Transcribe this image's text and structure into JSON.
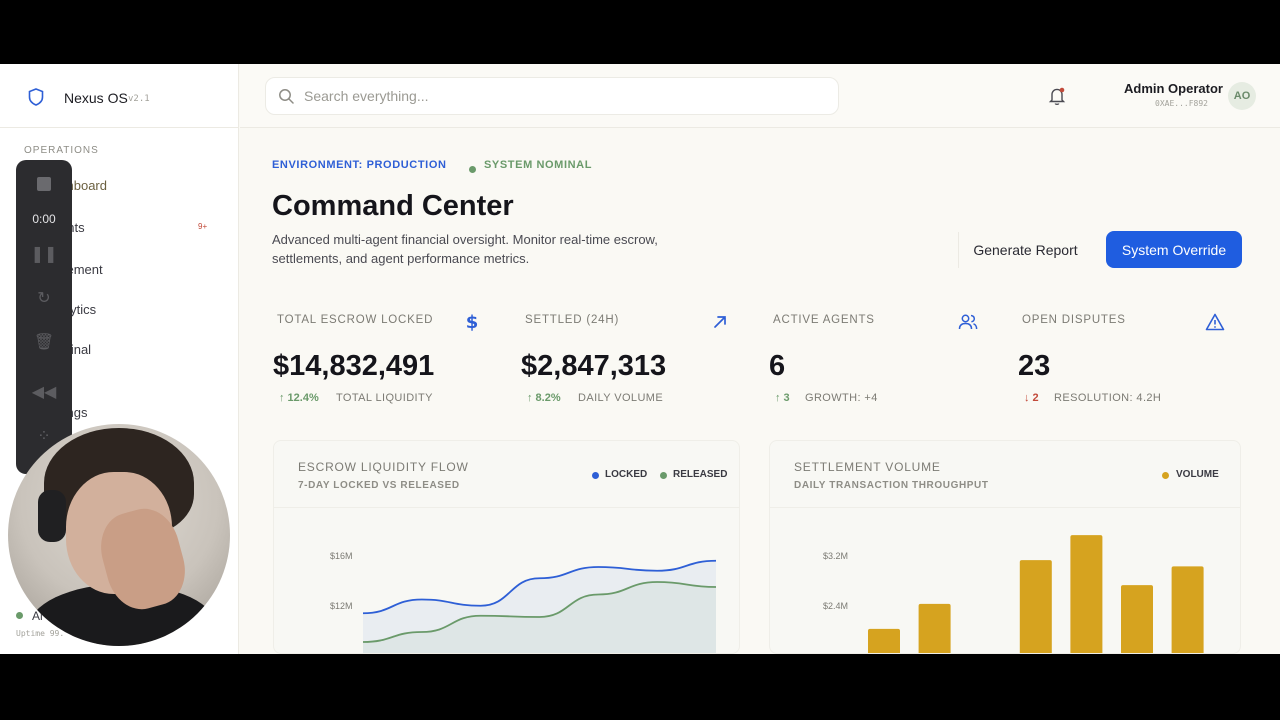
{
  "app": {
    "name": "Nexus OS",
    "version": "v2.1"
  },
  "sidebar": {
    "section": "OPERATIONS",
    "items": [
      {
        "label": "shboard",
        "active": true
      },
      {
        "label": "ents",
        "badge": "9+"
      },
      {
        "label": "tlement"
      },
      {
        "label": "alytics"
      },
      {
        "label": "minal"
      },
      {
        "label": "tings"
      }
    ],
    "status": "Al",
    "uptime": "Uptime 99."
  },
  "recorder": {
    "time": "0:00"
  },
  "search": {
    "placeholder": "Search everything..."
  },
  "user": {
    "name": "Admin Operator",
    "id": "0XAE...F892",
    "initials": "AO"
  },
  "header": {
    "environment": "ENVIRONMENT: PRODUCTION",
    "status": "SYSTEM NOMINAL",
    "title": "Command Center",
    "subtitle": "Advanced multi-agent financial oversight. Monitor real-time escrow, settlements, and agent performance metrics.",
    "report_button": "Generate Report",
    "override_button": "System Override"
  },
  "stats": [
    {
      "label": "TOTAL ESCROW LOCKED",
      "value": "$14,832,491",
      "delta": "↑ 12.4%",
      "meta": "TOTAL LIQUIDITY",
      "icon": "dollar-icon"
    },
    {
      "label": "SETTLED (24H)",
      "value": "$2,847,313",
      "delta": "↑ 8.2%",
      "meta": "DAILY VOLUME",
      "icon": "arrow-up-right-icon"
    },
    {
      "label": "ACTIVE AGENTS",
      "value": "6",
      "delta": "↑ 3",
      "meta": "GROWTH: +4",
      "icon": "users-icon"
    },
    {
      "label": "OPEN DISPUTES",
      "value": "23",
      "delta": "↓ 2",
      "meta": "RESOLUTION: 4.2H",
      "icon": "alert-triangle-icon"
    }
  ],
  "colors": {
    "accent": "#1f5de0",
    "positive": "#6a9a6a",
    "negative": "#c24a3a",
    "volume": "#d6a31f",
    "locked": "#2e5fd6"
  },
  "chart_data": [
    {
      "type": "line",
      "title": "ESCROW LIQUIDITY FLOW",
      "subtitle": "7-DAY LOCKED VS RELEASED",
      "y_ticks": [
        "$16M",
        "$12M"
      ],
      "ylim": [
        4,
        20
      ],
      "legend": "top-right",
      "series": [
        {
          "name": "LOCKED",
          "values": [
            11.5,
            12.6,
            12.1,
            14.3,
            15.2,
            14.9,
            15.7
          ]
        },
        {
          "name": "RELEASED",
          "values": [
            9.2,
            10.0,
            11.3,
            11.2,
            13.0,
            14.0,
            13.6
          ]
        }
      ]
    },
    {
      "type": "bar",
      "title": "SETTLEMENT VOLUME",
      "subtitle": "DAILY TRANSACTION THROUGHPUT",
      "y_ticks": [
        "$3.2M",
        "$2.4M"
      ],
      "ylim": [
        0,
        4.0
      ],
      "legend": "top-right",
      "series": [
        {
          "name": "VOLUME",
          "values": [
            2.05,
            2.45,
            1.65,
            3.15,
            3.55,
            2.75,
            3.05
          ]
        }
      ]
    }
  ]
}
